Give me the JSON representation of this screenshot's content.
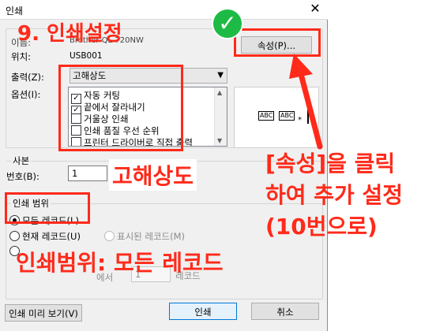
{
  "window": {
    "title": "인쇄",
    "close_glyph": "✕"
  },
  "printer": {
    "name_label": "이름:",
    "name_value": "Brother QL-720NW",
    "location_label": "위치:",
    "location_value": "USB001",
    "properties_button": "속성(P)..."
  },
  "output": {
    "label": "출력(Z):",
    "selected": "고해상도"
  },
  "options": {
    "label": "옵션(I):",
    "items": [
      {
        "label": "자동 커팅",
        "checked": true
      },
      {
        "label": "끝에서 잘라내기",
        "checked": true
      },
      {
        "label": "거울상 인쇄",
        "checked": false
      },
      {
        "label": "인쇄 품질 우선 순위",
        "checked": false
      },
      {
        "label": "프린터 드라이버로 직접 출력",
        "checked": false
      }
    ]
  },
  "preview": {
    "abc1": "ABC",
    "abc2": "ABC",
    "mark": "*"
  },
  "copies": {
    "section": "사본",
    "number_label": "번호(B):",
    "number_value": "1"
  },
  "range": {
    "section": "인쇄 범위",
    "all_records": "모든 레코드(L)",
    "current_record": "현재 레코드(U)",
    "shown_records": "표시된 레코드(M)",
    "to_label": "에서",
    "to_value": "1",
    "record_label": "레코드"
  },
  "footer": {
    "preview_button": "인쇄 미리 보기(V)",
    "print_button": "인쇄",
    "cancel_button": "취소"
  },
  "annotations": {
    "step_title": "9. 인쇄설정",
    "check_mark": "✓",
    "output_note": "고해상도",
    "properties_note_line1": "[속성]을 클릭",
    "properties_note_line2": "하여 추가 설정",
    "properties_note_line3": "(10번으로)",
    "range_note": "인쇄범위: 모든 레코드",
    "accent_color": "#ff2a1a",
    "check_color": "#1dbb45"
  }
}
